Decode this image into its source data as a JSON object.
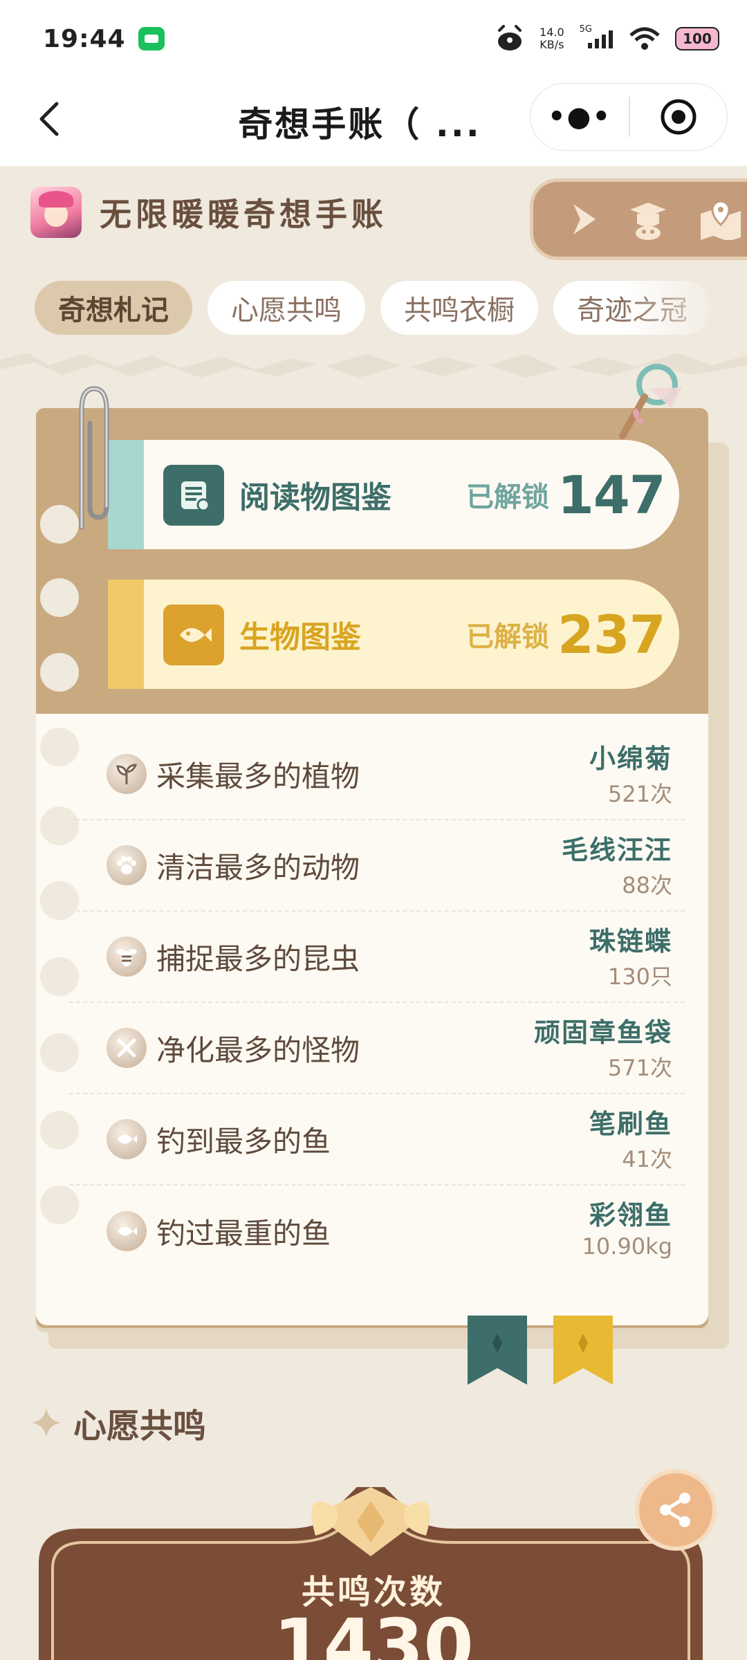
{
  "status_bar": {
    "time": "19:44",
    "speed_value": "14.0",
    "speed_unit": "KB/s",
    "signal_label": "5G",
    "battery": "100"
  },
  "nav": {
    "title": "奇想手账（ ..."
  },
  "header": {
    "book_title": "无限暖暖奇想手账"
  },
  "tabs": [
    "奇想札记",
    "心愿共鸣",
    "共鸣衣橱",
    "奇迹之冠"
  ],
  "catalogs": [
    {
      "label": "阅读物图鉴",
      "unlock_label": "已解锁",
      "count": "147",
      "color": "#3d6e69"
    },
    {
      "label": "生物图鉴",
      "unlock_label": "已解锁",
      "count": "237",
      "color": "#d8a521"
    }
  ],
  "stats": [
    {
      "label": "采集最多的植物",
      "name": "小绵菊",
      "count": "521次",
      "icon": "sprout-icon"
    },
    {
      "label": "清洁最多的动物",
      "name": "毛线汪汪",
      "count": "88次",
      "icon": "paw-icon"
    },
    {
      "label": "捕捉最多的昆虫",
      "name": "珠链蝶",
      "count": "130只",
      "icon": "bee-icon"
    },
    {
      "label": "净化最多的怪物",
      "name": "顽固章鱼袋",
      "count": "571次",
      "icon": "crossed-swords-icon"
    },
    {
      "label": "钓到最多的鱼",
      "name": "笔刷鱼",
      "count": "41次",
      "icon": "fish-icon"
    },
    {
      "label": "钓过最重的鱼",
      "name": "彩翎鱼",
      "count": "10.90kg",
      "icon": "fish-icon"
    }
  ],
  "section": {
    "title": "心愿共鸣"
  },
  "resonance": {
    "label": "共鸣次数",
    "value": "1430"
  },
  "colors": {
    "accent_teal": "#3d6e69",
    "accent_gold": "#d8a521",
    "board": "#c9a980",
    "paper": "#efe9de"
  }
}
